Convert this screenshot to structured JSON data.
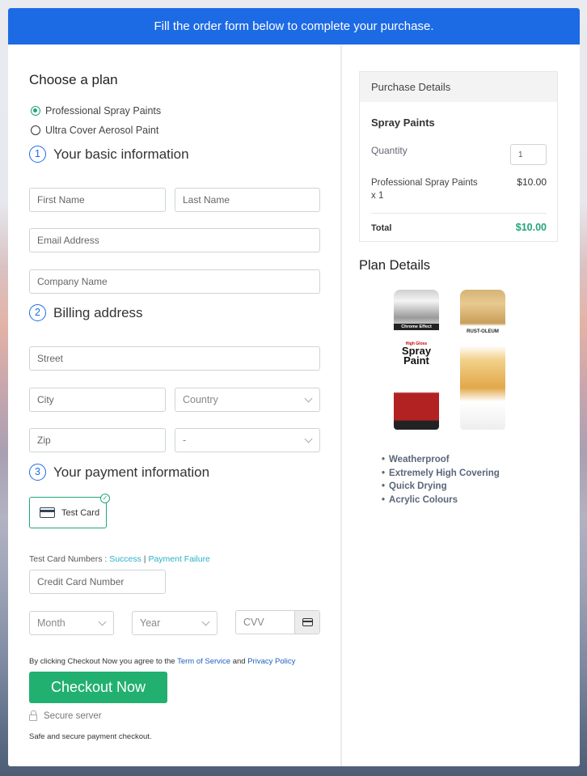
{
  "banner": {
    "text": "Fill the order form below to complete your purchase."
  },
  "plan": {
    "heading": "Choose a plan",
    "options": [
      {
        "label": "Professional Spray Paints",
        "selected": true
      },
      {
        "label": "Ultra Cover Aerosol Paint",
        "selected": false
      }
    ]
  },
  "sections": {
    "basic": {
      "number": "1",
      "title": "Your basic information"
    },
    "billing": {
      "number": "2",
      "title": "Billing address"
    },
    "payment": {
      "number": "3",
      "title": "Your payment information"
    }
  },
  "fields": {
    "first_name": "First Name",
    "last_name": "Last Name",
    "email": "Email Address",
    "company": "Company Name",
    "street": "Street",
    "city": "City",
    "country": "Country",
    "zip": "Zip",
    "state": "-",
    "card_number": "Credit Card Number",
    "month": "Month",
    "year": "Year",
    "cvv": "CVV"
  },
  "payment": {
    "method_label": "Test Card",
    "test_numbers_label": "Test Card Numbers : ",
    "success_link": "Success",
    "separator": " | ",
    "failure_link": "Payment Failure"
  },
  "terms": {
    "prefix": "By clicking Checkout Now you agree to the ",
    "tos_link": "Term of Service",
    "middle": " and ",
    "privacy_link": "Privacy Policy"
  },
  "checkout": {
    "button_label": "Checkout Now",
    "secure_label": "Secure server",
    "safe_text": "Safe and secure payment checkout."
  },
  "purchase": {
    "heading": "Purchase Details",
    "product_title": "Spray Paints",
    "quantity_label": "Quantity",
    "quantity_value": "1",
    "item_label": "Professional Spray Paints x 1",
    "item_price": "$10.00",
    "total_label": "Total",
    "total_value": "$10.00"
  },
  "plan_details": {
    "heading": "Plan Details",
    "products": [
      {
        "name": "Chrome Effect High Gloss Spray Paint",
        "band": "Chrome Effect",
        "subtitle": "High Gloss",
        "title": "Spray Paint"
      },
      {
        "name": "Rust-Oleum Metallic Gold",
        "brand": "RUST-OLEUM"
      }
    ],
    "features": [
      "Weatherproof",
      "Extremely High Covering",
      "Quick Drying",
      "Acrylic Colours"
    ]
  },
  "colors": {
    "primary": "#1d6ae5",
    "success": "#22b070",
    "link": "#2bb0c4",
    "total": "#22a57a"
  }
}
